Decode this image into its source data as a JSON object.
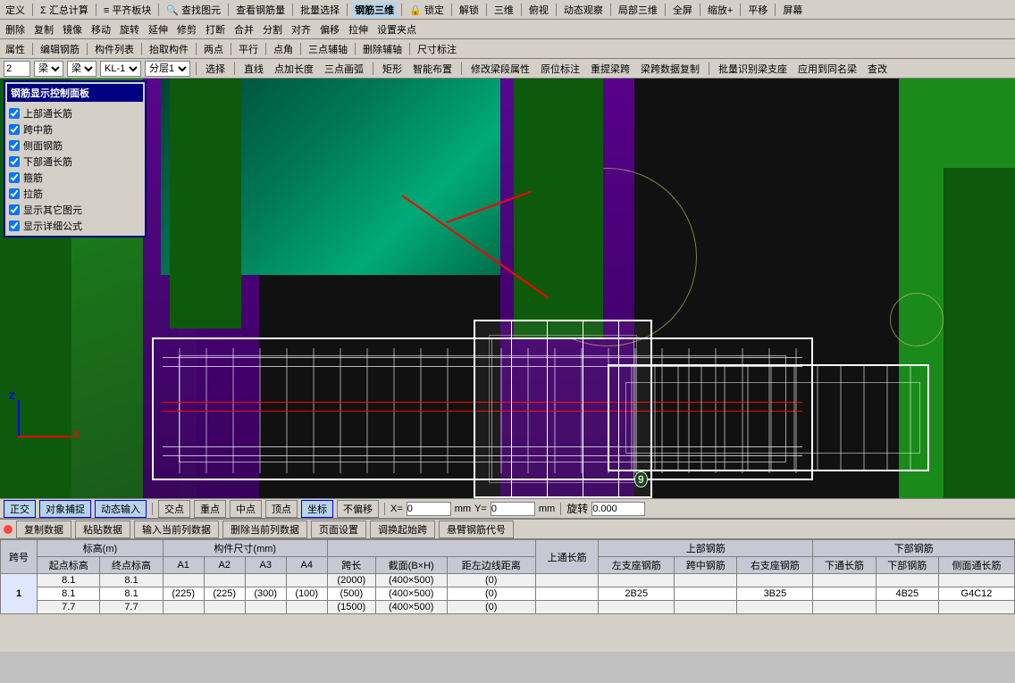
{
  "toolbar1": {
    "items": [
      {
        "label": "定义",
        "icon": "define"
      },
      {
        "label": "Σ 汇总计算",
        "icon": "sum"
      },
      {
        "label": "≡ 平齐板块",
        "icon": "align"
      },
      {
        "label": "🔍 查找图元",
        "icon": "search"
      },
      {
        "label": "查看钢筋量",
        "icon": "view"
      },
      {
        "label": "批量选择",
        "icon": "batch"
      },
      {
        "label": "钢筋三维",
        "icon": "3d-rebar",
        "active": true
      },
      {
        "label": "🔒 锁定",
        "icon": "lock"
      },
      {
        "label": "解锁",
        "icon": "unlock"
      },
      {
        "label": "三维",
        "icon": "3d"
      },
      {
        "label": "俯视",
        "icon": "top-view"
      },
      {
        "label": "动态观察",
        "icon": "dynamic"
      },
      {
        "label": "局部三维",
        "icon": "local-3d"
      },
      {
        "label": "全屏",
        "icon": "fullscreen"
      },
      {
        "label": "缩放+",
        "icon": "zoom-in"
      },
      {
        "label": "平移",
        "icon": "pan"
      },
      {
        "label": "屏幕",
        "icon": "screen"
      }
    ]
  },
  "toolbar2": {
    "items": [
      {
        "label": "删除"
      },
      {
        "label": "复制"
      },
      {
        "label": "镜像"
      },
      {
        "label": "移动"
      },
      {
        "label": "旋转"
      },
      {
        "label": "延伸"
      },
      {
        "label": "修剪"
      },
      {
        "label": "打断"
      },
      {
        "label": "合并"
      },
      {
        "label": "分割"
      },
      {
        "label": "对齐"
      },
      {
        "label": "偏移"
      },
      {
        "label": "拉伸"
      },
      {
        "label": "设置夹点"
      }
    ]
  },
  "toolbar3": {
    "items": [
      {
        "label": "属性"
      },
      {
        "label": "编辑钢筋"
      },
      {
        "label": "构件列表"
      },
      {
        "label": "抬取构件"
      },
      {
        "label": "两点"
      },
      {
        "label": "平行"
      },
      {
        "label": "点角"
      },
      {
        "label": "三点辅轴"
      },
      {
        "label": "删除辅轴"
      },
      {
        "label": "尺寸标注"
      }
    ]
  },
  "inputrow": {
    "num_value": "2",
    "type1": "梁",
    "type2": "梁",
    "type3": "KL-1",
    "layer": "分层1",
    "buttons": [
      "选择",
      "直线",
      "点加长度",
      "三点画弧",
      "矩形",
      "智能布置",
      "修改梁段属性",
      "原位标注",
      "重提梁跨",
      "梁跨数据复制",
      "批量识别梁支座",
      "应用到同名梁",
      "查改"
    ]
  },
  "rebarPanel": {
    "title": "钢筋显示控制面板",
    "items": [
      {
        "label": "上部通长筋",
        "checked": true
      },
      {
        "label": "跨中筋",
        "checked": true
      },
      {
        "label": "侧面钢筋",
        "checked": true
      },
      {
        "label": "下部通长筋",
        "checked": true
      },
      {
        "label": "箍筋",
        "checked": true
      },
      {
        "label": "拉筋",
        "checked": true
      },
      {
        "label": "显示其它图元",
        "checked": true
      },
      {
        "label": "显示详细公式",
        "checked": true
      }
    ]
  },
  "statusbar": {
    "items": [
      "正交",
      "对象捕捉",
      "动态输入",
      "交点",
      "重点",
      "中点",
      "顶点",
      "坐标",
      "不偏移"
    ],
    "active": [
      "正交",
      "对象捕捉",
      "动态输入",
      "坐标"
    ],
    "x_label": "X=",
    "x_value": "0",
    "x_unit": "mm",
    "y_label": "Y=",
    "y_value": "0",
    "y_unit": "mm",
    "rotate_label": "旋转",
    "rotate_value": "0.000"
  },
  "datapanel": {
    "buttons": [
      "复制数据",
      "粘贴数据",
      "输入当前列数据",
      "删除当前列数据",
      "页面设置",
      "调换起始跨",
      "悬臂钢筋代号"
    ],
    "table": {
      "headers": {
        "row1": [
          "跨号",
          "标高(m)",
          "",
          "构件尺寸(mm)",
          "",
          "",
          "",
          "",
          "",
          "",
          "上通长筋",
          "上部钢筋",
          "",
          "",
          "下部钢筋",
          "",
          ""
        ],
        "row2": [
          "",
          "起点标高",
          "终点标高",
          "A1",
          "A2",
          "A3",
          "A4",
          "跨长",
          "截面(B×H)",
          "距左边线距离",
          "",
          "左支座钢筋",
          "跨中钢筋",
          "右支座钢筋",
          "下通长筋",
          "下部钢筋",
          "侧面通长筋"
        ]
      },
      "rows": [
        {
          "rowNum": "1",
          "spanNum": "1",
          "data": [
            [
              "",
              "8.1",
              "8.1",
              "",
              "",
              "",
              "",
              "(2000)",
              "(400×500)",
              "(0)",
              "",
              "",
              "",
              "",
              "",
              "",
              ""
            ],
            [
              "",
              "8.1",
              "8.1",
              "(225)",
              "(225)",
              "(300)",
              "(100)",
              "(500)",
              "(400×500)",
              "(0)",
              "",
              "2B25",
              "",
              "3B25",
              "",
              "4B25",
              "G4C12"
            ],
            [
              "",
              "7.7",
              "7.7",
              "",
              "",
              "",
              "",
              "(1500)",
              "(400×500)",
              "(0)",
              "",
              "",
              "",
              "",
              "",
              "",
              ""
            ]
          ]
        }
      ]
    }
  },
  "scene": {
    "axis_x": "X",
    "axis_z": "Z",
    "point_label": "9"
  }
}
